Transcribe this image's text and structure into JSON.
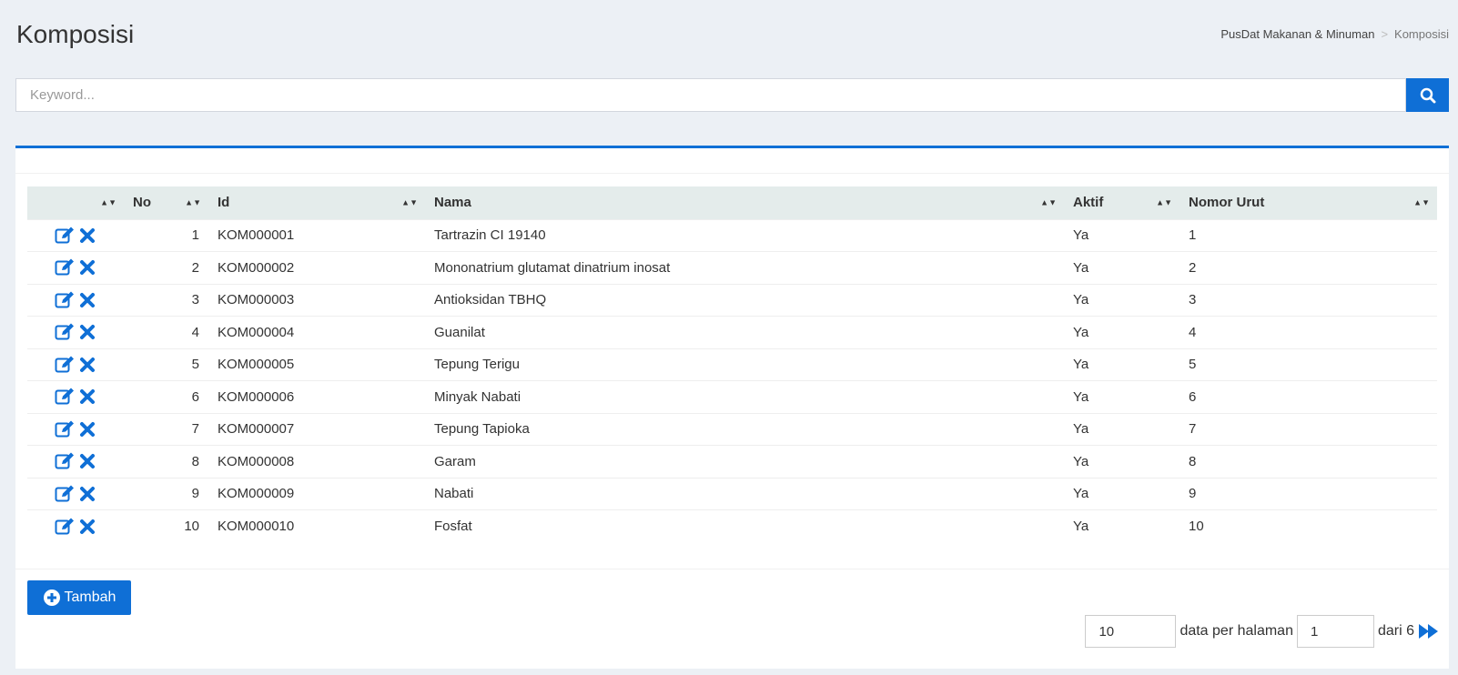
{
  "page": {
    "title": "Komposisi"
  },
  "breadcrumb": {
    "items": [
      "PusDat Makanan & Minuman",
      "Komposisi"
    ],
    "separator": ">"
  },
  "search": {
    "placeholder": "Keyword...",
    "value": ""
  },
  "table": {
    "headers": [
      "",
      "No",
      "Id",
      "Nama",
      "Aktif",
      "Nomor Urut"
    ],
    "rows": [
      {
        "no": "1",
        "id": "KOM000001",
        "nama": "Tartrazin CI 19140",
        "aktif": "Ya",
        "urut": "1"
      },
      {
        "no": "2",
        "id": "KOM000002",
        "nama": "Mononatrium glutamat dinatrium inosat",
        "aktif": "Ya",
        "urut": "2"
      },
      {
        "no": "3",
        "id": "KOM000003",
        "nama": "Antioksidan TBHQ",
        "aktif": "Ya",
        "urut": "3"
      },
      {
        "no": "4",
        "id": "KOM000004",
        "nama": "Guanilat",
        "aktif": "Ya",
        "urut": "4"
      },
      {
        "no": "5",
        "id": "KOM000005",
        "nama": "Tepung Terigu",
        "aktif": "Ya",
        "urut": "5"
      },
      {
        "no": "6",
        "id": "KOM000006",
        "nama": "Minyak Nabati",
        "aktif": "Ya",
        "urut": "6"
      },
      {
        "no": "7",
        "id": "KOM000007",
        "nama": "Tepung Tapioka",
        "aktif": "Ya",
        "urut": "7"
      },
      {
        "no": "8",
        "id": "KOM000008",
        "nama": "Garam",
        "aktif": "Ya",
        "urut": "8"
      },
      {
        "no": "9",
        "id": "KOM000009",
        "nama": "Nabati",
        "aktif": "Ya",
        "urut": "9"
      },
      {
        "no": "10",
        "id": "KOM000010",
        "nama": "Fosfat",
        "aktif": "Ya",
        "urut": "10"
      }
    ]
  },
  "actions": {
    "add_label": "Tambah",
    "icons": [
      "edit-icon",
      "delete-icon"
    ]
  },
  "pager": {
    "per_page_value": "10",
    "per_page_label": "data per halaman",
    "page_value": "1",
    "total_label": "dari 6"
  },
  "colors": {
    "accent": "#0f6fd6",
    "background": "#ecf0f5",
    "header_row": "#e4eceb"
  }
}
